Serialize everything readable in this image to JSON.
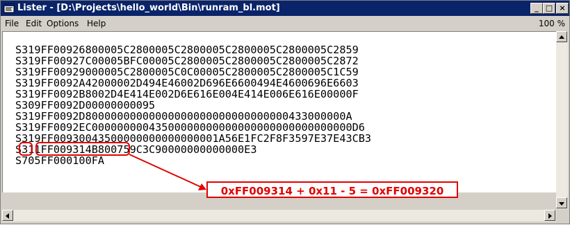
{
  "window": {
    "title": "Lister - [D:\\Projects\\hello_world\\Bin\\runram_bl.mot]",
    "minimize_glyph": "_",
    "restore_glyph": "□",
    "close_glyph": "×"
  },
  "menu": {
    "items": [
      "File",
      "Edit",
      "Options",
      "Help"
    ],
    "zoom": "100 %"
  },
  "lines": [
    "S319FF00926800005C2800005C2800005C2800005C2800005C2859",
    "S319FF00927C00005BFC00005C2800005C2800005C2800005C2872",
    "S319FF00929000005C2800005C0C00005C2800005C2800005C1C59",
    "S319FF0092A42000002D494E46002D696E6600494E4600696E6603",
    "S319FF0092B8002D4E414E002D6E616E004E414E006E616E00000F",
    "S309FF0092D00000000095",
    "S319FF0092D80000000000000000000000000000000433000000A",
    "S319FF0092EC00000000043500000000000000000000000000000D6",
    "S319FF00930043500000000000000001A56E1FC2F8F3597E37E43CB3",
    "S311FF009314B800759C3C90000000000000E3",
    "S705FF000100FA"
  ],
  "annotation": {
    "text": "0xFF009314 + 0x11 - 5 = 0xFF009320",
    "color": "#e00000"
  }
}
